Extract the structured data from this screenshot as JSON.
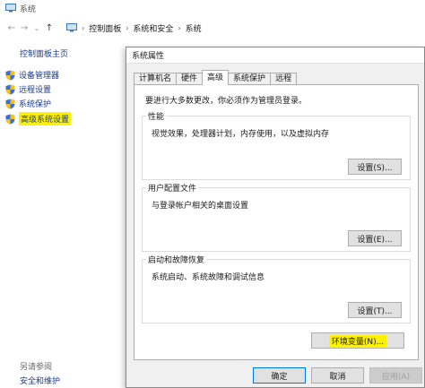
{
  "window": {
    "title": "系统"
  },
  "address_bar": {
    "back": "←",
    "forward": "→",
    "recent": "⌄",
    "up": "↑",
    "crumbs": [
      "控制面板",
      "系统和安全",
      "系统"
    ],
    "sep": "›"
  },
  "sidebar": {
    "home": "控制面板主页",
    "items": [
      {
        "label": "设备管理器"
      },
      {
        "label": "远程设置"
      },
      {
        "label": "系统保护"
      },
      {
        "label": "高级系统设置",
        "highlighted": true
      }
    ],
    "see_also": "另请参阅",
    "security": "安全和维护"
  },
  "dialog": {
    "title": "系统属性",
    "tabs": [
      "计算机名",
      "硬件",
      "高级",
      "系统保护",
      "远程"
    ],
    "active_tab": "高级",
    "admin_note": "要进行大多数更改，你必须作为管理员登录。",
    "groups": {
      "performance": {
        "label": "性能",
        "desc": "视觉效果，处理器计划，内存使用，以及虚拟内存",
        "button": "设置(S)..."
      },
      "profiles": {
        "label": "用户配置文件",
        "desc": "与登录帐户相关的桌面设置",
        "button": "设置(E)..."
      },
      "startup": {
        "label": "启动和故障恢复",
        "desc": "系统启动、系统故障和调试信息",
        "button": "设置(T)..."
      }
    },
    "env_button": "环境变量(N)...",
    "ok": "确定",
    "cancel": "取消",
    "apply": "应用(A)"
  },
  "colors": {
    "highlight": "#fff200",
    "link": "#1a3a8a",
    "accent": "#0078d7"
  }
}
